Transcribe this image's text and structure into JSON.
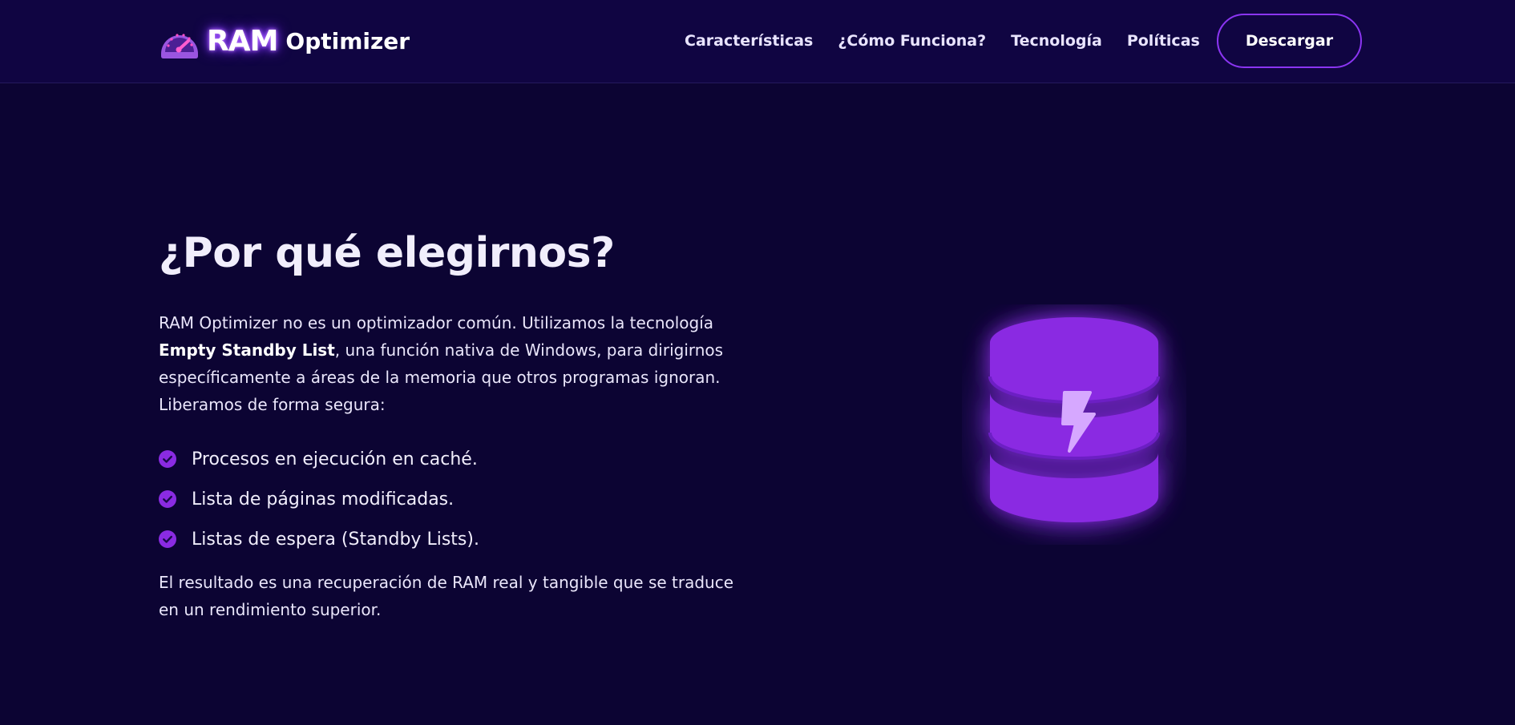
{
  "header": {
    "brand": {
      "logo_icon": "speedometer-icon",
      "name_bold": "RAM",
      "name_rest": "Optimizer"
    },
    "nav": [
      {
        "label": "Características"
      },
      {
        "label": "¿Cómo Funciona?"
      },
      {
        "label": "Tecnología"
      },
      {
        "label": "Políticas"
      }
    ],
    "download_label": "Descargar"
  },
  "main": {
    "title": "¿Por qué elegirnos?",
    "intro": {
      "before": "RAM Optimizer no es un optimizador común. Utilizamos la tecnología ",
      "highlight": "Empty Standby List",
      "after": ", una función nativa de Windows, para dirigirnos específicamente a áreas de la memoria que otros programas ignoran. Liberamos de forma segura:"
    },
    "features": [
      {
        "icon": "check-circle-icon",
        "text": "Procesos en ejecución en caché."
      },
      {
        "icon": "check-circle-icon",
        "text": "Lista de páginas modificadas."
      },
      {
        "icon": "check-circle-icon",
        "text": "Listas de espera (Standby Lists)."
      }
    ],
    "result": "El resultado es una recuperación de RAM real y tangible que se traduce en un rendimiento superior.",
    "illustration_icon": "database-lightning-icon"
  },
  "colors": {
    "background": "#0c0433",
    "header_background": "#100542",
    "accent": "#8b35f2",
    "check": "#8a2be2",
    "database": "#8a2be2",
    "bolt": "#d6a8ff"
  }
}
